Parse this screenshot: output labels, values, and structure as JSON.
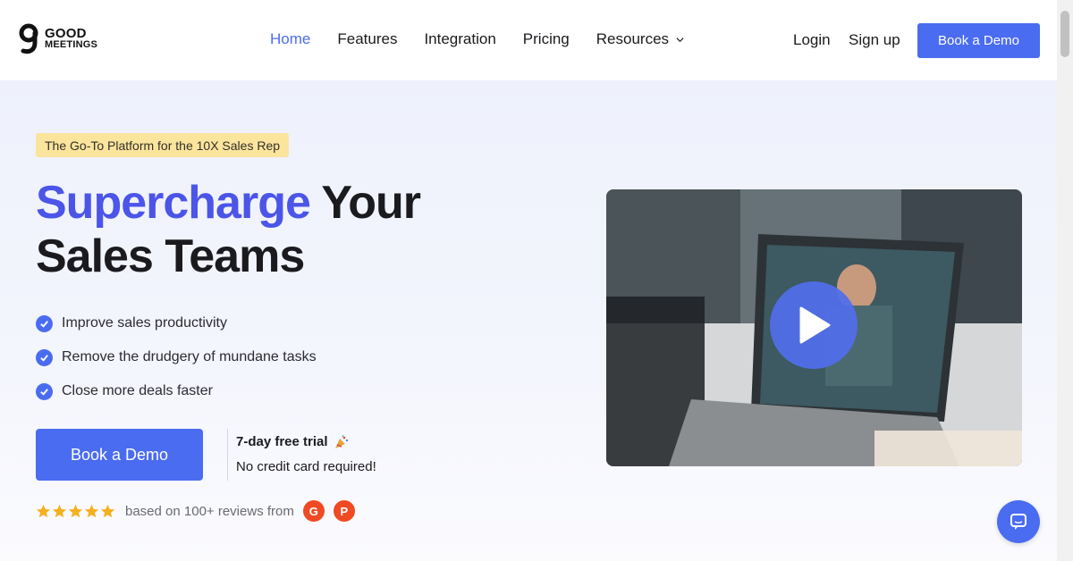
{
  "brand": {
    "line1": "GOOD",
    "line2": "MEETINGS",
    "logo_icon": "g-logo-icon"
  },
  "nav": {
    "items": [
      {
        "label": "Home",
        "active": true
      },
      {
        "label": "Features"
      },
      {
        "label": "Integration"
      },
      {
        "label": "Pricing"
      },
      {
        "label": "Resources",
        "icon": "chevron-down-icon"
      }
    ],
    "login": "Login",
    "signup": "Sign up",
    "cta": "Book a Demo"
  },
  "hero": {
    "tag": "The Go-To Platform for the 10X Sales Rep",
    "headline_accent": "Supercharge",
    "headline_rest_1": " Your",
    "headline_line2": "Sales Teams",
    "bullets": [
      "Improve sales productivity",
      "Remove the drudgery of mundane tasks",
      "Close more deals faster"
    ],
    "cta": "Book a Demo",
    "trial_title": "7-day free trial",
    "trial_sub": "No credit card required!",
    "reviews_text": "based on 100+ reviews from",
    "rating_stars": 5,
    "review_sources": [
      "G",
      "P"
    ]
  },
  "colors": {
    "accent": "#4a6cf0",
    "headline_accent": "#4b55e8",
    "tag_bg": "#fbe49c",
    "star": "#f6b01e"
  }
}
